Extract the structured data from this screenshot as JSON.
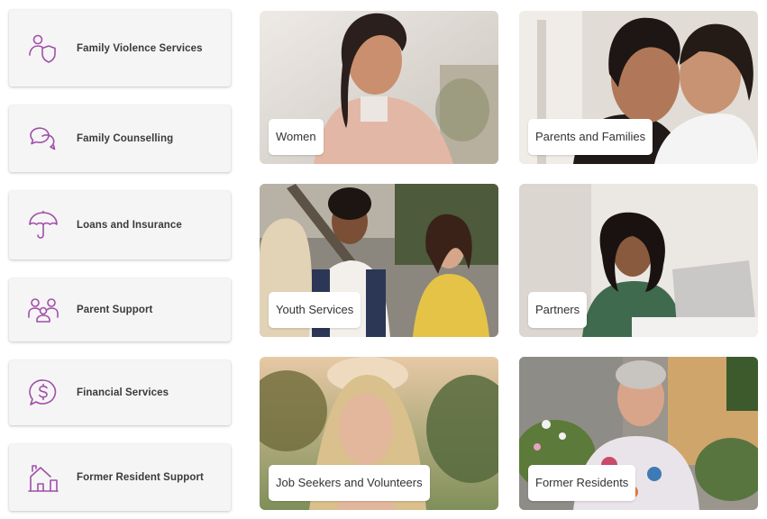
{
  "accent_color": "#a050a8",
  "services": [
    {
      "label": "Family Violence Services",
      "icon": "person-shield-icon"
    },
    {
      "label": "Family Counselling",
      "icon": "speech-bubbles-icon"
    },
    {
      "label": "Loans and Insurance",
      "icon": "umbrella-icon"
    },
    {
      "label": "Parent Support",
      "icon": "family-group-icon"
    },
    {
      "label": "Financial Services",
      "icon": "dollar-speech-bubble-icon"
    },
    {
      "label": "Former Resident Support",
      "icon": "house-icon"
    }
  ],
  "cards": [
    {
      "label": "Women"
    },
    {
      "label": "Parents and Families"
    },
    {
      "label": "Youth Services"
    },
    {
      "label": "Partners"
    },
    {
      "label": "Job Seekers and Volunteers"
    },
    {
      "label": "Former Residents"
    }
  ]
}
